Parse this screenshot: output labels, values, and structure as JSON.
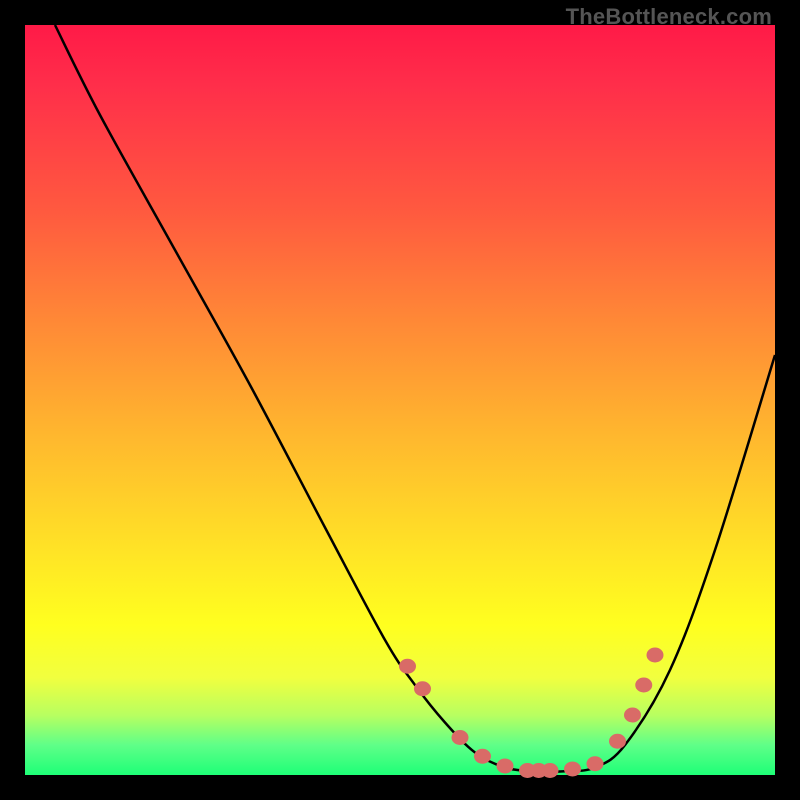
{
  "watermark": "TheBottleneck.com",
  "chart_data": {
    "type": "line",
    "title": "",
    "xlabel": "",
    "ylabel": "",
    "xlim": [
      0,
      100
    ],
    "ylim": [
      0,
      100
    ],
    "grid": false,
    "legend": false,
    "series": [
      {
        "name": "bottleneck-curve",
        "x": [
          4,
          10,
          20,
          30,
          40,
          48,
          52,
          56,
          60,
          64,
          68,
          72,
          76,
          80,
          86,
          92,
          100
        ],
        "y": [
          100,
          88,
          70,
          52,
          33,
          18,
          12,
          7,
          3,
          1,
          0.5,
          0.5,
          1,
          4,
          14,
          30,
          56
        ]
      }
    ],
    "markers": {
      "name": "highlighted-points",
      "x": [
        51,
        53,
        58,
        61,
        64,
        67,
        68.5,
        70,
        73,
        76,
        79,
        81,
        82.5,
        84
      ],
      "y": [
        14.5,
        11.5,
        5,
        2.5,
        1.2,
        0.6,
        0.6,
        0.6,
        0.8,
        1.5,
        4.5,
        8,
        12,
        16
      ]
    },
    "gradient_stops": [
      {
        "pos": 0,
        "color": "#ff1a47"
      },
      {
        "pos": 25,
        "color": "#ff5a3f"
      },
      {
        "pos": 55,
        "color": "#ffb82e"
      },
      {
        "pos": 80,
        "color": "#ffff1f"
      },
      {
        "pos": 100,
        "color": "#1eff77"
      }
    ]
  }
}
